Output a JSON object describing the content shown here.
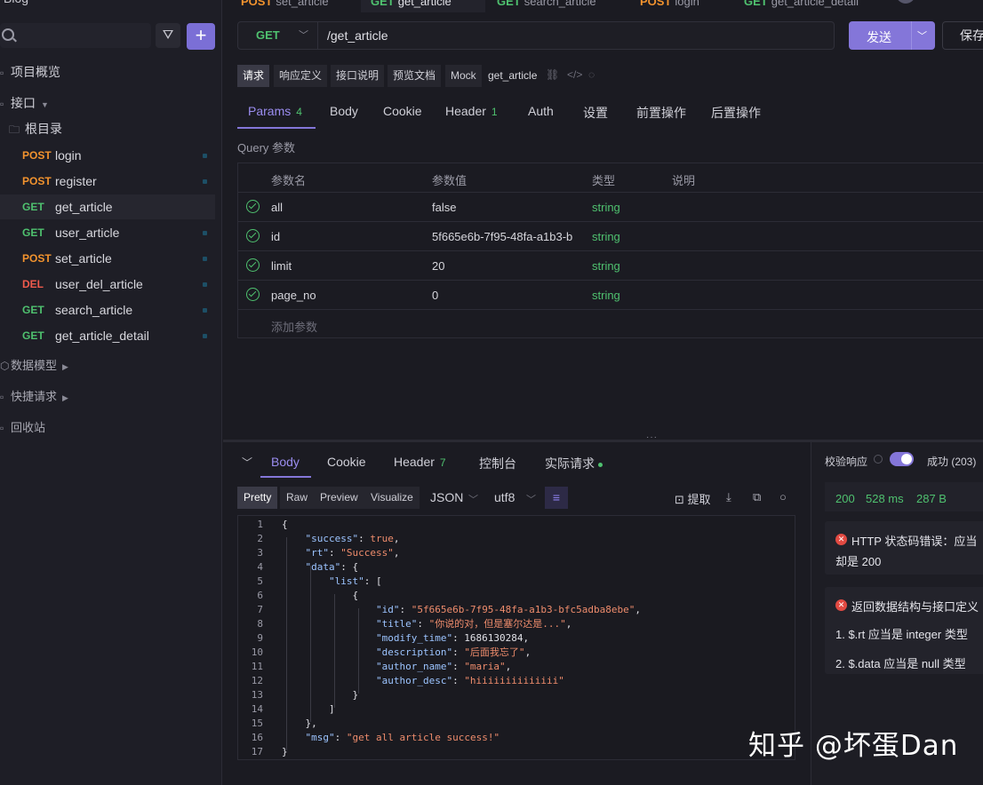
{
  "app": {
    "title": "Blog"
  },
  "sidebar": {
    "overview": "项目概览",
    "apis_section": "接口",
    "root_folder": "根目录",
    "items": [
      {
        "method": "POST",
        "name": "login"
      },
      {
        "method": "POST",
        "name": "register"
      },
      {
        "method": "GET",
        "name": "get_article"
      },
      {
        "method": "GET",
        "name": "user_article"
      },
      {
        "method": "POST",
        "name": "set_article"
      },
      {
        "method": "DEL",
        "name": "user_del_article"
      },
      {
        "method": "GET",
        "name": "search_article"
      },
      {
        "method": "GET",
        "name": "get_article_detail"
      }
    ],
    "models": "数据模型",
    "quick_requests": "快捷请求",
    "trash": "回收站"
  },
  "top_tabs": [
    {
      "method": "POST",
      "name": "set_article"
    },
    {
      "method": "GET",
      "name": "get_article"
    },
    {
      "method": "GET",
      "name": "search_article"
    },
    {
      "method": "POST",
      "name": "login"
    },
    {
      "method": "GET",
      "name": "get_article_detail"
    }
  ],
  "url_bar": {
    "method": "GET",
    "path": "/get_article"
  },
  "actions": {
    "send": "发送",
    "save": "保存"
  },
  "view_tabs": [
    "请求",
    "响应定义",
    "接口说明",
    "预览文档",
    "Mock"
  ],
  "api_name": "get_article",
  "request_tabs": {
    "params": "Params",
    "params_count": "4",
    "body": "Body",
    "cookie": "Cookie",
    "header": "Header",
    "header_count": "1",
    "auth": "Auth",
    "settings": "设置",
    "pre": "前置操作",
    "post": "后置操作"
  },
  "query_label": "Query 参数",
  "params_table": {
    "headers": [
      "参数名",
      "参数值",
      "类型",
      "说明"
    ],
    "rows": [
      {
        "name": "all",
        "value": "false",
        "type": "string"
      },
      {
        "name": "id",
        "value": "5f665e6b-7f95-48fa-a1b3-b",
        "type": "string"
      },
      {
        "name": "limit",
        "value": "20",
        "type": "string"
      },
      {
        "name": "page_no",
        "value": "0",
        "type": "string"
      }
    ],
    "add_placeholder": "添加参数"
  },
  "response_tabs": {
    "body": "Body",
    "cookie": "Cookie",
    "header": "Header",
    "header_count": "7",
    "console": "控制台",
    "actual": "实际请求"
  },
  "format_bar": {
    "tabs": [
      "Pretty",
      "Raw",
      "Preview",
      "Visualize"
    ],
    "type": "JSON",
    "encoding": "utf8",
    "extract": "提取"
  },
  "code_lines": [
    "{",
    "    \"success\": true,",
    "    \"rt\": \"Success\",",
    "    \"data\": {",
    "        \"list\": [",
    "            {",
    "                \"id\": \"5f665e6b-7f95-48fa-a1b3-bfc5adba8ebe\",",
    "                \"title\": \"你说的对，但是塞尔达是...\",",
    "                \"modify_time\": 1686130284,",
    "                \"description\": \"后面我忘了\",",
    "                \"author_name\": \"maria\",",
    "                \"author_desc\": \"hiiiiiiiiiiiiii\"",
    "            }",
    "        ]",
    "    },",
    "    \"msg\": \"get all article success!\"",
    "}"
  ],
  "validation": {
    "label": "校验响应",
    "result": "成功 (203)",
    "status": "200",
    "time": "528 ms",
    "size": "287 B",
    "error1_line1": "HTTP 状态码错误：应当",
    "error1_line2": "却是 200",
    "error2_title": "返回数据结构与接口定义",
    "error2_item1": "1. $.rt 应当是 integer 类型",
    "error2_item2": "2. $.data 应当是 null 类型"
  },
  "watermark": "知乎 @坏蛋Dan",
  "colors": {
    "accent": "#8476d9",
    "get": "#4fc16f",
    "post": "#f2932e",
    "del": "#ef5a4c",
    "error": "#e24a42"
  }
}
